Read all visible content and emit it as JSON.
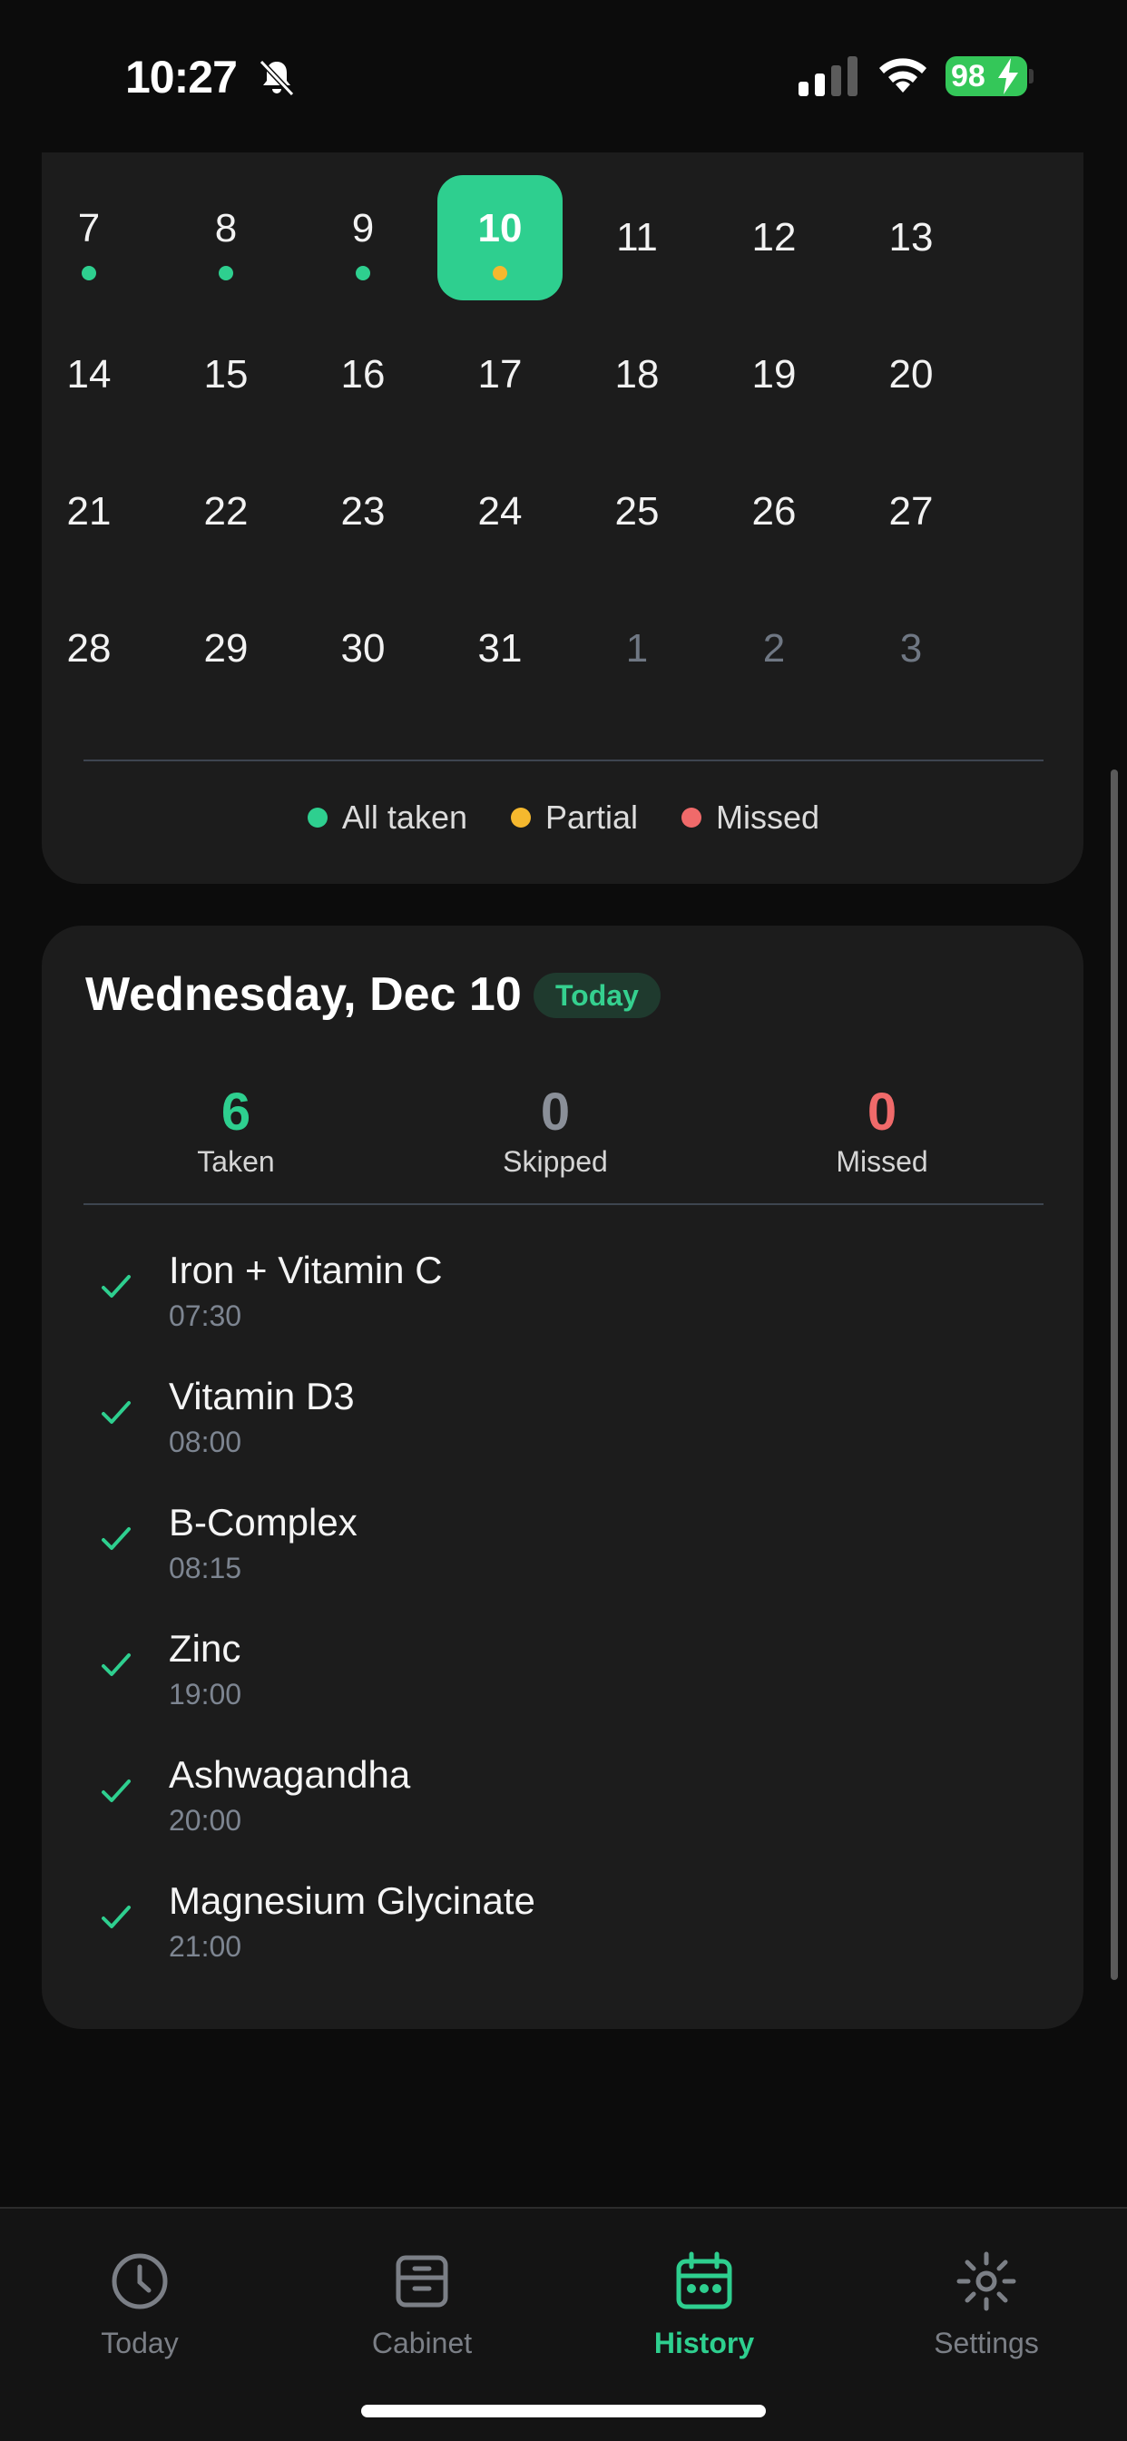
{
  "status_bar": {
    "time": "10:27",
    "battery": "98"
  },
  "calendar": {
    "weeks": [
      [
        {
          "d": "7",
          "dot": "taken"
        },
        {
          "d": "8",
          "dot": "taken"
        },
        {
          "d": "9",
          "dot": "taken"
        },
        {
          "d": "10",
          "dot": "partial",
          "selected": true
        },
        {
          "d": "11"
        },
        {
          "d": "12"
        },
        {
          "d": "13"
        }
      ],
      [
        {
          "d": "14"
        },
        {
          "d": "15"
        },
        {
          "d": "16"
        },
        {
          "d": "17"
        },
        {
          "d": "18"
        },
        {
          "d": "19"
        },
        {
          "d": "20"
        }
      ],
      [
        {
          "d": "21"
        },
        {
          "d": "22"
        },
        {
          "d": "23"
        },
        {
          "d": "24"
        },
        {
          "d": "25"
        },
        {
          "d": "26"
        },
        {
          "d": "27"
        }
      ],
      [
        {
          "d": "28"
        },
        {
          "d": "29"
        },
        {
          "d": "30"
        },
        {
          "d": "31"
        },
        {
          "d": "1",
          "muted": true
        },
        {
          "d": "2",
          "muted": true
        },
        {
          "d": "3",
          "muted": true
        }
      ]
    ],
    "legend": [
      {
        "label": "All taken",
        "color": "#2ecf8f"
      },
      {
        "label": "Partial",
        "color": "#f5b82e"
      },
      {
        "label": "Missed",
        "color": "#f06a6a"
      }
    ]
  },
  "colors": {
    "taken": "#2ecf8f",
    "partial": "#f5b82e",
    "missed": "#f06a6a",
    "skipped": "#8a8f98"
  },
  "detail": {
    "title": "Wednesday, Dec 10",
    "badge": "Today",
    "stats": {
      "taken": {
        "value": "6",
        "label": "Taken"
      },
      "skipped": {
        "value": "0",
        "label": "Skipped"
      },
      "missed": {
        "value": "0",
        "label": "Missed"
      }
    },
    "meds": [
      {
        "name": "Iron + Vitamin C",
        "time": "07:30"
      },
      {
        "name": "Vitamin D3",
        "time": "08:00"
      },
      {
        "name": "B-Complex",
        "time": "08:15"
      },
      {
        "name": "Zinc",
        "time": "19:00"
      },
      {
        "name": "Ashwagandha",
        "time": "20:00"
      },
      {
        "name": "Magnesium Glycinate",
        "time": "21:00"
      }
    ]
  },
  "tabs": [
    {
      "label": "Today",
      "icon": "clock-icon"
    },
    {
      "label": "Cabinet",
      "icon": "cabinet-icon"
    },
    {
      "label": "History",
      "icon": "calendar-icon",
      "active": true
    },
    {
      "label": "Settings",
      "icon": "gear-icon"
    }
  ]
}
